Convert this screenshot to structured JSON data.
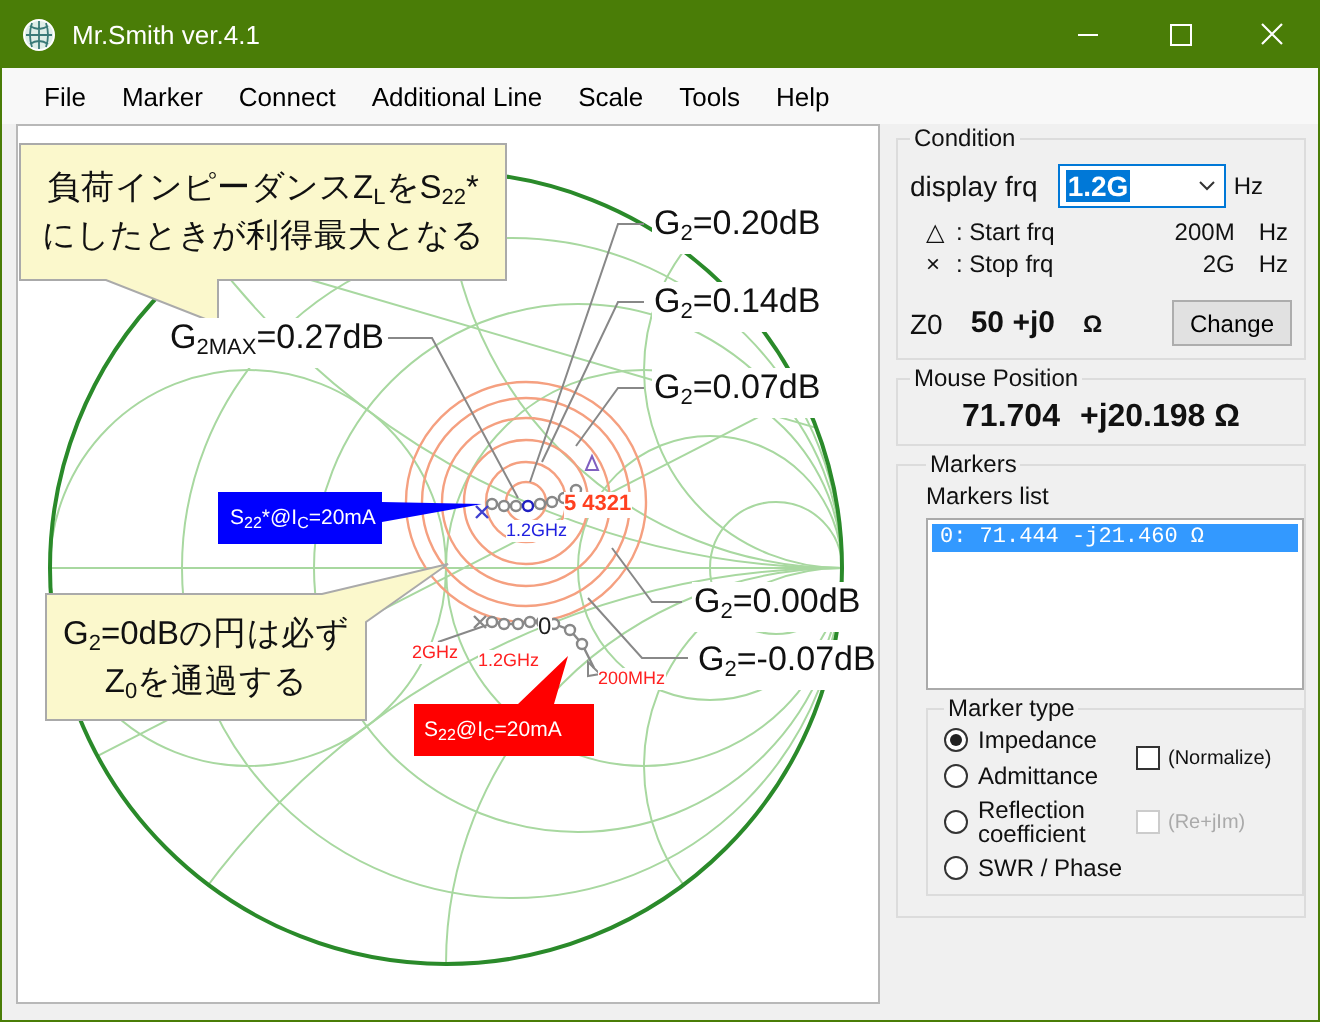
{
  "window": {
    "title": "Mr.Smith ver.4.1"
  },
  "menu": [
    "File",
    "Marker",
    "Connect",
    "Additional Line",
    "Scale",
    "Tools",
    "Help"
  ],
  "chart": {
    "callouts": [
      {
        "lines": [
          "負荷インピーダンスZ$_{L}$をS$_{22}$*",
          "にしたときが利得最大となる"
        ]
      },
      {
        "lines": [
          "G$_{2}$=0dBの円は必ず",
          "Z$_{0}$を通過する"
        ]
      }
    ],
    "flags": [
      {
        "text": "S$_{22}$*@I$_{C}$=20mA",
        "color": "#0000ff"
      },
      {
        "text": "S$_{22}$@I$_{C}$=20mA",
        "color": "#ff0000"
      }
    ],
    "gain_labels": [
      "G$_{2}$=0.20dB",
      "G$_{2}$=0.14dB",
      "G$_{2}$=0.07dB",
      "G$_{2MAX}$=0.27dB",
      "G$_{2}$=0.00dB",
      "G$_{2}$=-0.07dB"
    ],
    "point_labels": [
      {
        "text": "5 4321",
        "color": "#ff4020"
      },
      {
        "text": "1.2GHz",
        "color": "#2020e0"
      },
      {
        "text": "0",
        "color": "#202020"
      },
      {
        "text": "2GHz",
        "color": "#ff2020"
      },
      {
        "text": "1.2GHz",
        "color": "#ff2020"
      },
      {
        "text": "200MHz",
        "color": "#ff2020"
      }
    ]
  },
  "condition": {
    "title": "Condition",
    "display_label": "display frq",
    "display_value": "1.2G",
    "display_unit": "Hz",
    "rows": [
      {
        "symbol": "△",
        "label": ": Start frq",
        "value": "200M",
        "unit": "Hz"
      },
      {
        "symbol": "×",
        "label": ": Stop frq",
        "value": "2G",
        "unit": "Hz"
      }
    ],
    "z0_label": "Z0",
    "z0_value": "50 +j0",
    "z0_unit": "Ω",
    "change_button": "Change"
  },
  "mouse": {
    "title": "Mouse Position",
    "real": "71.704",
    "imag": "+j20.198 Ω"
  },
  "markers": {
    "title": "Markers",
    "list_label": "Markers list",
    "items": [
      {
        "text": "0: 71.444 -j21.460 Ω",
        "selected": true
      }
    ],
    "marker_type": {
      "title": "Marker type",
      "options": [
        {
          "label": "Impedance",
          "selected": true
        },
        {
          "label": "Admittance",
          "selected": false
        },
        {
          "label": "Reflection coefficient",
          "selected": false
        },
        {
          "label": "SWR / Phase",
          "selected": false
        }
      ],
      "normalize": {
        "label": "(Normalize)",
        "checked": false,
        "disabled": false
      },
      "re_im": {
        "label": "(Re+jIm)",
        "checked": false,
        "disabled": true
      }
    }
  }
}
